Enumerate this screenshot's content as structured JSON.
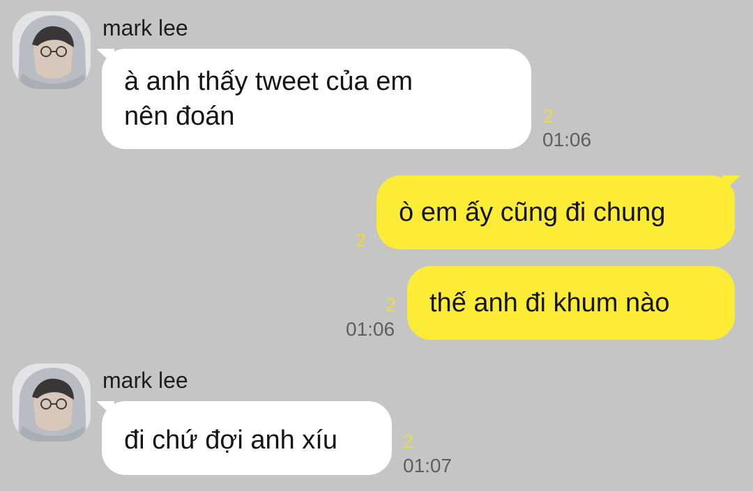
{
  "conversation": {
    "messages": [
      {
        "sender": "mark lee",
        "text": "à anh thấy tweet của em\nnên đoán",
        "unread": "2",
        "time": "01:06"
      },
      {
        "text": "ò em ấy cũng đi chung",
        "unread": "2"
      },
      {
        "text": "thế anh đi khum nào",
        "unread": "2",
        "time": "01:06"
      },
      {
        "sender": "mark lee",
        "text": "đi chứ đợi anh xíu",
        "unread": "2",
        "time": "01:07"
      }
    ]
  }
}
